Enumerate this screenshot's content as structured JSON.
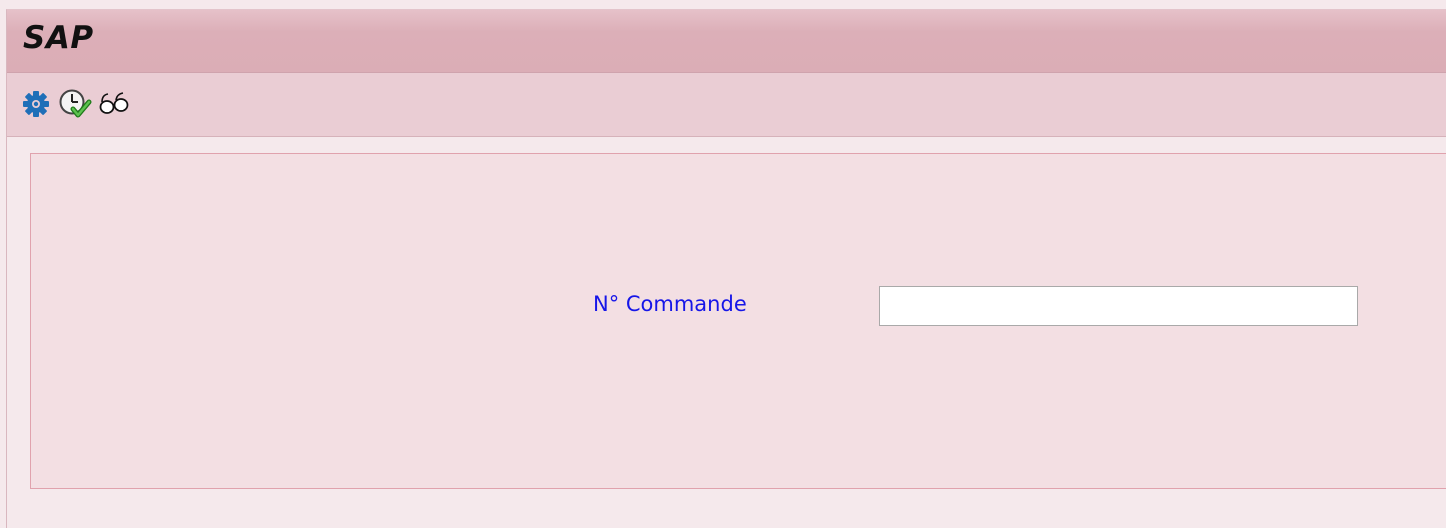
{
  "window": {
    "title": "SAP"
  },
  "toolbar": {
    "buttons": [
      {
        "icon": "gear-icon",
        "tooltip": ""
      },
      {
        "icon": "clock-check-icon",
        "tooltip": ""
      },
      {
        "icon": "glasses-icon",
        "tooltip": ""
      }
    ]
  },
  "form": {
    "order_number": {
      "label": "N° Commande",
      "value": "",
      "placeholder": ""
    }
  },
  "colors": {
    "title_bar": "#dbadb6",
    "toolbar": "#eacdd4",
    "background": "#f5e9ec",
    "content_panel": "#f3dfe3",
    "panel_border": "#e0a2ad",
    "label_text": "#1616e8",
    "gear_icon": "#1f6fb8",
    "check_icon": "#3aa335"
  }
}
